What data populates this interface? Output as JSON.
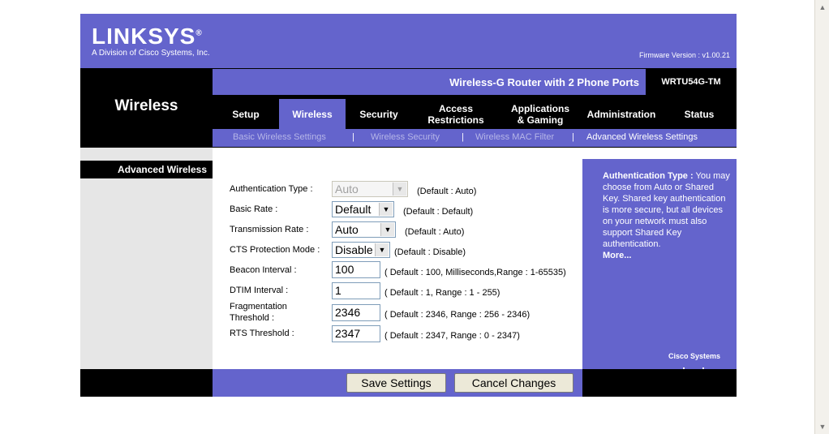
{
  "header": {
    "logo": "LINKSYS",
    "logo_mark": "®",
    "division": "A Division of Cisco Systems, Inc.",
    "firmware": "Firmware Version  : v1.00.21"
  },
  "model": {
    "name": "Wireless-G Router with 2 Phone Ports",
    "id": "WRTU54G-TM"
  },
  "section_title": "Wireless",
  "tabs": [
    {
      "label": "Setup"
    },
    {
      "label": "Wireless"
    },
    {
      "label": "Security"
    },
    {
      "label": "Access Restrictions"
    },
    {
      "label": "Applications & Gaming"
    },
    {
      "label": "Administration"
    },
    {
      "label": "Status"
    }
  ],
  "subnav": [
    {
      "label": "Basic Wireless Settings"
    },
    {
      "label": "Wireless Security"
    },
    {
      "label": "Wireless MAC Filter"
    },
    {
      "label": "Advanced Wireless Settings"
    }
  ],
  "separator": "|",
  "left_label": "Advanced Wireless",
  "form": {
    "auth_type": {
      "label": "Authentication Type  :",
      "value": "Auto",
      "note": "(Default : Auto)"
    },
    "basic_rate": {
      "label": "Basic Rate  :",
      "value": "Default",
      "note": "(Default : Default)"
    },
    "tx_rate": {
      "label": "Transmission Rate  :",
      "value": "Auto",
      "note": "(Default : Auto)"
    },
    "cts": {
      "label": "CTS Protection Mode  :",
      "value": "Disable",
      "note": "(Default :  Disable)"
    },
    "beacon": {
      "label": "Beacon Interval  :",
      "value": "100",
      "note": "( Default : 100, Milliseconds,Range  : 1-65535)"
    },
    "dtim": {
      "label": "DTIM Interval  :",
      "value": "1",
      "note": "( Default  : 1, Range  : 1 - 255)"
    },
    "frag": {
      "label_1": "Fragmentation",
      "label_2": "Threshold  :",
      "value": "2346",
      "note": "( Default  : 2346, Range  : 256 - 2346)"
    },
    "rts": {
      "label": "RTS Threshold  :",
      "value": "2347",
      "note": "( Default  : 2347, Range  : 0 - 2347)"
    }
  },
  "help": {
    "title": "Authentication Type :",
    "text": "You may choose from Auto or Shared Key. Shared key authentication is more secure, but all devices on your network must also support Shared Key authentication.",
    "more": "More..."
  },
  "cisco": "Cisco Systems",
  "buttons": {
    "save": "Save Settings",
    "cancel": "Cancel Changes"
  },
  "colors": {
    "brand": "#6464cc",
    "black": "#000000"
  }
}
